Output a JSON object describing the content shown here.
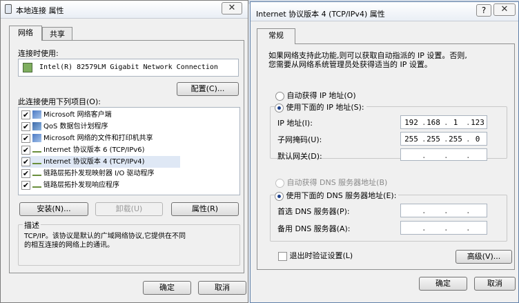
{
  "left_dialog": {
    "title": "本地连接 属性",
    "tabs": [
      "网络",
      "共享"
    ],
    "connect_using_label": "连接时使用:",
    "adapter_name": "Intel(R) 82579LM Gigabit Network Connection",
    "configure_button": "配置(C)...",
    "items_label": "此连接使用下列项目(O):",
    "items": [
      {
        "label": "Microsoft 网络客户端",
        "checked": true,
        "icon": "network-client-icon"
      },
      {
        "label": "QoS 数据包计划程序",
        "checked": true,
        "icon": "qos-icon"
      },
      {
        "label": "Microsoft 网络的文件和打印机共享",
        "checked": true,
        "icon": "file-printer-sharing-icon"
      },
      {
        "label": "Internet 协议版本 6 (TCP/IPv6)",
        "checked": true,
        "icon": "protocol-icon"
      },
      {
        "label": "Internet 协议版本 4 (TCP/IPv4)",
        "checked": true,
        "icon": "protocol-icon",
        "selected": true
      },
      {
        "label": "链路层拓扑发现映射器 I/O 驱动程序",
        "checked": true,
        "icon": "protocol-icon"
      },
      {
        "label": "链路层拓扑发现响应程序",
        "checked": true,
        "icon": "protocol-icon"
      }
    ],
    "install_button": "安装(N)...",
    "uninstall_button": "卸载(U)",
    "properties_button": "属性(R)",
    "description_label": "描述",
    "description_text_line1": "TCP/IP。该协议是默认的广域网络协议,它提供在不同",
    "description_text_line2": "的相互连接的网络上的通讯。",
    "ok_button": "确定",
    "cancel_button": "取消"
  },
  "right_dialog": {
    "title": "Internet 协议版本 4 (TCP/IPv4) 属性",
    "tab": "常规",
    "intro_line1": "如果网络支持此功能,则可以获取自动指派的 IP 设置。否则,",
    "intro_line2": "您需要从网络系统管理员处获得适当的 IP 设置。",
    "auto_ip_label": "自动获得 IP 地址(O)",
    "manual_ip_label": "使用下面的 IP 地址(S):",
    "ip_address_label": "IP 地址(I):",
    "ip_address": [
      "192",
      "168",
      "1",
      "123"
    ],
    "subnet_label": "子网掩码(U):",
    "subnet_mask": [
      "255",
      "255",
      "255",
      "0"
    ],
    "gateway_label": "默认网关(D):",
    "gateway": [
      "",
      "",
      "",
      ""
    ],
    "auto_dns_label": "自动获得 DNS 服务器地址(B)",
    "manual_dns_label": "使用下面的 DNS 服务器地址(E):",
    "preferred_dns_label": "首选 DNS 服务器(P):",
    "preferred_dns": [
      "",
      "",
      "",
      ""
    ],
    "alternate_dns_label": "备用 DNS 服务器(A):",
    "alternate_dns": [
      "",
      "",
      "",
      ""
    ],
    "validate_label": "退出时验证设置(L)",
    "validate_checked": false,
    "advanced_button": "高级(V)...",
    "ok_button": "确定",
    "cancel_button": "取消",
    "ip_mode": "manual",
    "dns_mode": "manual"
  },
  "colors": {
    "selected_item_bg": "#dfe8f5",
    "title_text": "#000000",
    "accent": "#1b3f8b"
  }
}
